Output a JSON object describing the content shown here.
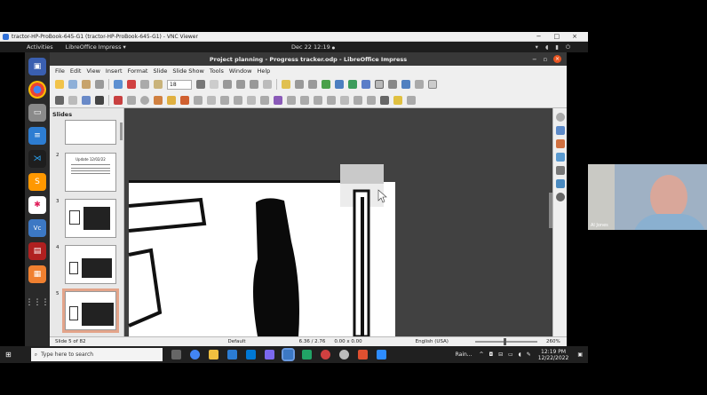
{
  "vnc": {
    "title": "tractor-HP-ProBook-645-G1 (tractor-HP-ProBook-645-G1) - VNC Viewer",
    "minimize": "−",
    "maximize": "□",
    "close": "×"
  },
  "ubuntu": {
    "activities": "Activities",
    "app_menu": "LibreOffice Impress ▾",
    "clock": "Dec 22  12:19",
    "clock_dot": "●"
  },
  "dock": {
    "items": [
      "screen-icon",
      "chrome-icon",
      "files-icon",
      "docs-icon",
      "vscode-icon",
      "sublime-icon",
      "slack-icon",
      "vnc-icon",
      "stack-icon",
      "notes-icon",
      "apps-grid-icon"
    ]
  },
  "window": {
    "title": "Project planning - Progress tracker.odp - LibreOffice Impress",
    "close": "×"
  },
  "menu": [
    "File",
    "Edit",
    "View",
    "Insert",
    "Format",
    "Slide",
    "Slide Show",
    "Tools",
    "Window",
    "Help"
  ],
  "toolbar": {
    "font_size": "18"
  },
  "slides_pane": {
    "header": "Slides",
    "thumbs": [
      {
        "num": "",
        "title": ""
      },
      {
        "num": "2",
        "title": "Update 12/02/22"
      },
      {
        "num": "3",
        "title": ""
      },
      {
        "num": "4",
        "title": ""
      },
      {
        "num": "5",
        "title": ""
      }
    ]
  },
  "status": {
    "slide": "Slide 5 of 82",
    "master": "Default",
    "position": "6.36 / 2.76",
    "size": "0.00 x 0.00",
    "language": "English (USA)",
    "zoom": "260%"
  },
  "taskbar": {
    "search_placeholder": "Type here to search",
    "weather": "Rain...",
    "time": "12:19 PM",
    "date": "12/22/2022"
  },
  "webcam": {
    "name": "Al Jones"
  },
  "colors": {
    "ubuntu_accent": "#e95420",
    "selection": "#e3a48a",
    "dock": "#2a2a2a"
  }
}
